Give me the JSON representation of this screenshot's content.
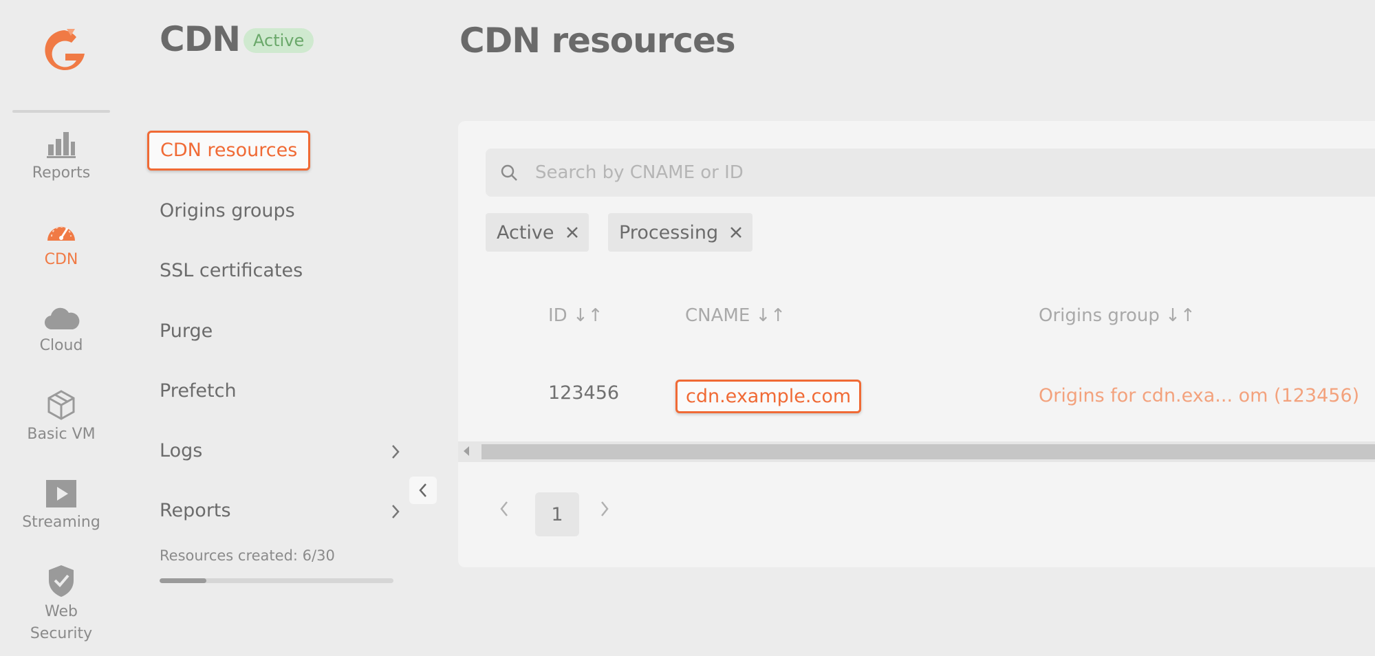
{
  "rail": {
    "items": [
      {
        "label": "Reports",
        "icon": "bar-chart-icon"
      },
      {
        "label": "CDN",
        "icon": "speedometer-icon",
        "active": true
      },
      {
        "label": "Cloud",
        "icon": "cloud-icon"
      },
      {
        "label": "Basic VM",
        "icon": "cube-icon"
      },
      {
        "label": "Streaming",
        "icon": "play-icon"
      },
      {
        "label": "Web Security",
        "icon": "shield-icon"
      }
    ]
  },
  "subnav": {
    "title": "CDN",
    "status_badge": "Active",
    "items": [
      {
        "label": "CDN resources",
        "selected": true
      },
      {
        "label": "Origins groups"
      },
      {
        "label": "SSL certificates"
      },
      {
        "label": "Purge"
      },
      {
        "label": "Prefetch"
      },
      {
        "label": "Logs",
        "has_submenu": true
      },
      {
        "label": "Reports",
        "has_submenu": true
      }
    ],
    "usage_label": "Resources created: 6/30",
    "usage_fraction": 0.2
  },
  "main": {
    "title": "CDN resources",
    "search": {
      "placeholder": "Search by CNAME or ID",
      "value": ""
    },
    "filters": [
      {
        "label": "Active"
      },
      {
        "label": "Processing"
      }
    ],
    "table": {
      "columns": [
        "ID ↓↑",
        "CNAME ↓↑",
        "Origins group ↓↑"
      ],
      "rows": [
        {
          "id": "123456",
          "cname": "cdn.example.com",
          "origins_group": "Origins for cdn.exa... om (123456)"
        }
      ]
    },
    "pagination": {
      "current_page": "1"
    }
  },
  "colors": {
    "accent": "#f06a35",
    "accent_light": "#f3a27d",
    "badge_bg": "#cfe9cf",
    "badge_text": "#6aa86a",
    "background": "#ececec",
    "panel": "#f4f4f4"
  }
}
